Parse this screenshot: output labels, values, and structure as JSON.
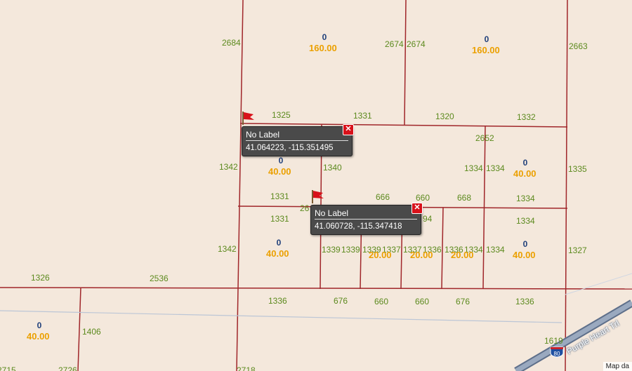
{
  "map": {
    "attribution": "Map da",
    "colors": {
      "background": "#f4e8dc",
      "parcel_line": "#a0262a",
      "dimension_text": "#5c8a1e",
      "owner_count": "#1f3f7a",
      "acreage": "#eba000",
      "highway": "#6f86a6"
    },
    "dimensions": [
      "2684",
      "2674",
      "2674",
      "2663",
      "1325",
      "1331",
      "1320",
      "1332",
      "2652",
      "1342",
      "1340",
      "1335",
      "1334",
      "1334",
      "1331",
      "666",
      "660",
      "668",
      "1334",
      "26",
      "1331",
      "94",
      "1334",
      "1342",
      "1339",
      "1339",
      "1339",
      "1337",
      "1337",
      "1336",
      "1336",
      "1334",
      "1334",
      "1327",
      "1326",
      "2536",
      "1336",
      "676",
      "660",
      "660",
      "676",
      "1336",
      "1406",
      "1619",
      "2715",
      "2726",
      "2718"
    ],
    "parcels": [
      {
        "owners": "0",
        "acreage": "160.00"
      },
      {
        "owners": "0",
        "acreage": "160.00"
      },
      {
        "owners": "0",
        "acreage": "40.00"
      },
      {
        "owners": "0",
        "acreage": "40.00"
      },
      {
        "owners": "0",
        "acreage": "40.00"
      },
      {
        "owners": "0",
        "acreage": "40.00"
      },
      {
        "owners": "0",
        "acreage": "20.00"
      },
      {
        "owners": "0",
        "acreage": "20.00"
      },
      {
        "owners": "0",
        "acreage": "20.00"
      },
      {
        "owners": "0",
        "acreage": "40.00"
      }
    ],
    "markers": [
      {
        "icon": "red-flag-icon",
        "label": "No Label",
        "coords": "41.064223, -115.351495",
        "close_symbol": "✕"
      },
      {
        "icon": "red-flag-icon",
        "label": "No Label",
        "coords": "41.060728, -115.347418",
        "close_symbol": "✕"
      }
    ],
    "highway": {
      "shield_icon": "interstate-shield-icon",
      "shield_number": "80",
      "road_name": "Purple Heart Trl"
    }
  }
}
